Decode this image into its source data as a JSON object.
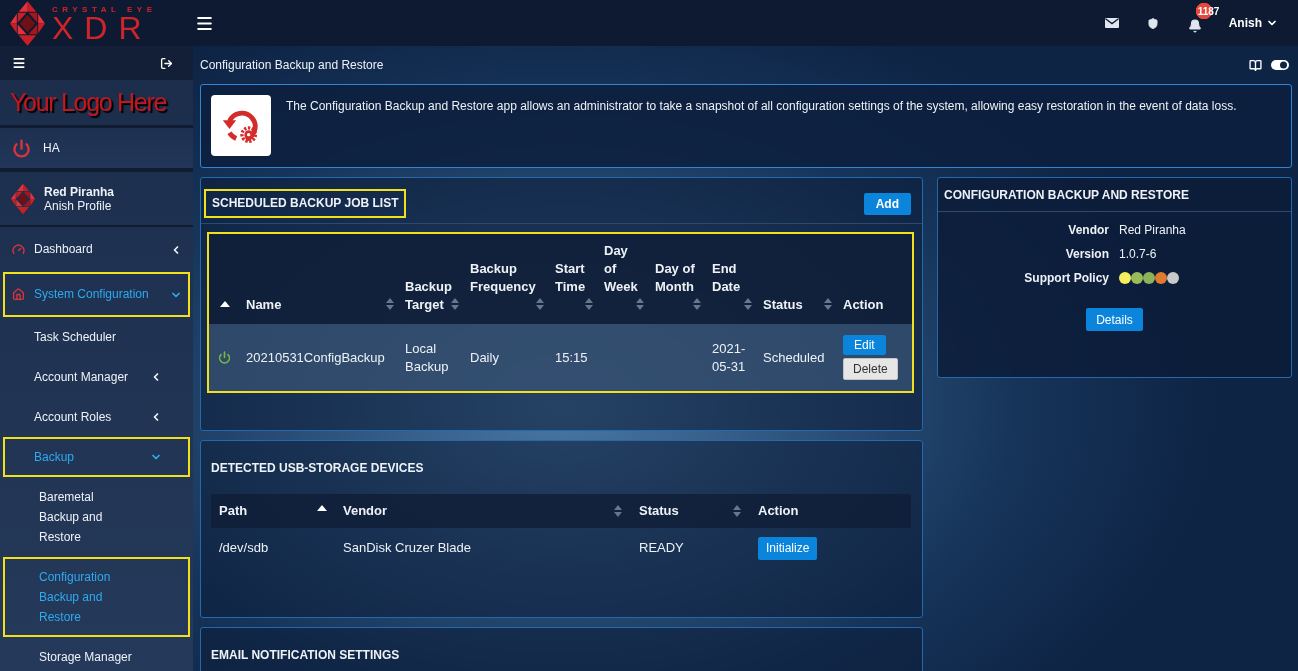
{
  "top_bar": {
    "logo": {
      "brand": "CRYSTAL EYE",
      "product": "XDR"
    },
    "notifications": {
      "count": "1187"
    },
    "user": {
      "name": "Anish"
    }
  },
  "sidebar": {
    "custom_logo": "Your Logo Here",
    "ha": {
      "label": "HA"
    },
    "profile": {
      "company": "Red Piranha",
      "name": "Anish Profile"
    },
    "items": [
      {
        "label": "Dashboard",
        "selected": false,
        "highlighted": false,
        "expanded": false
      },
      {
        "label": "System Configuration",
        "selected": true,
        "highlighted": true,
        "expanded": true,
        "children": [
          {
            "label": "Task Scheduler",
            "selected": false,
            "highlighted": false
          },
          {
            "label": "Account Manager",
            "selected": false,
            "highlighted": false,
            "expanded": false
          },
          {
            "label": "Account Roles",
            "selected": false,
            "highlighted": false,
            "expanded": false
          },
          {
            "label": "Backup",
            "selected": true,
            "highlighted": true,
            "expanded": true,
            "children": [
              {
                "label": "Baremetal Backup and Restore",
                "selected": false,
                "highlighted": false
              },
              {
                "label": "Configuration Backup and Restore",
                "selected": true,
                "highlighted": true
              },
              {
                "label": "Storage Manager",
                "selected": false,
                "highlighted": false
              }
            ]
          }
        ]
      }
    ]
  },
  "breadcrumb": {
    "title": "Configuration Backup and Restore"
  },
  "intro": {
    "text": "The Configuration Backup and Restore app allows an administrator to take a snapshot of all configuration settings of the system, allowing easy restoration in the event of data loss."
  },
  "job_list": {
    "title": {
      "text": "SCHEDULED BACKUP JOB LIST",
      "highlighted": true
    },
    "add_button": "Add",
    "table": {
      "highlighted": true,
      "columns": [
        {
          "sortable": true,
          "sorted": true
        },
        {
          "label": "Name",
          "sortable": true,
          "sorted": false
        },
        {
          "label": "Backup Target",
          "sortable": true,
          "sorted": false
        },
        {
          "label": "Backup Frequency",
          "sortable": true,
          "sorted": false
        },
        {
          "label": "Start Time",
          "sortable": true,
          "sorted": false
        },
        {
          "label": "Day of Week",
          "sortable": true,
          "sorted": false
        },
        {
          "label": "Day of Month",
          "sortable": true,
          "sorted": false
        },
        {
          "label": "End Date",
          "sortable": true,
          "sorted": false
        },
        {
          "label": "Status",
          "sortable": true,
          "sorted": false
        },
        {
          "label": "Action",
          "sortable": false
        }
      ],
      "rows": [
        {
          "enabled": true,
          "name": "20210531ConfigBackup",
          "backup_target": "Local Backup",
          "backup_frequency": "Daily",
          "start_time": "15:15",
          "end_date": "2021-05-31",
          "status": "Scheduled",
          "actions": [
            {
              "label": "Edit",
              "kind": "primary"
            },
            {
              "label": "Delete",
              "kind": "default"
            }
          ]
        }
      ]
    }
  },
  "usb_devices": {
    "title": "DETECTED USB-STORAGE DEVICES",
    "columns": [
      {
        "label": "Path",
        "sortable": true,
        "sorted": true
      },
      {
        "label": "Vendor",
        "sortable": true,
        "sorted": false
      },
      {
        "label": "Status",
        "sortable": true,
        "sorted": false
      },
      {
        "label": "Action",
        "sortable": false
      }
    ],
    "rows": [
      {
        "path": "/dev/sdb",
        "vendor": "SanDisk Cruzer Blade",
        "status": "READY",
        "action": "Initialize"
      }
    ]
  },
  "email_notifications": {
    "title": "EMAIL NOTIFICATION SETTINGS"
  },
  "app_info": {
    "title": "CONFIGURATION BACKUP AND RESTORE",
    "fields": [
      {
        "kind": "text",
        "label": "Vendor",
        "value": "Red Piranha"
      },
      {
        "kind": "text",
        "label": "Version",
        "value": "1.0.7-6"
      },
      {
        "kind": "dots",
        "label": "Support Policy",
        "dots": [
          {
            "color": "#f4ef5c"
          },
          {
            "color": "#9bbb59"
          },
          {
            "color": "#8db35a"
          },
          {
            "color": "#e07a2e"
          },
          {
            "color": "#c9c9c9"
          }
        ]
      }
    ],
    "button": "Details"
  }
}
